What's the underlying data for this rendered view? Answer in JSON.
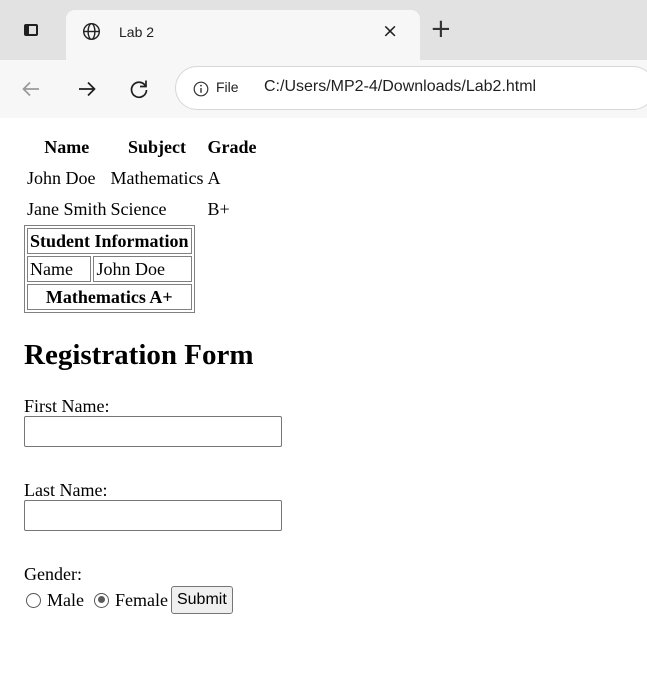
{
  "browser": {
    "tab_title": "Lab 2",
    "close_glyph": "×",
    "new_tab_glyph": "+",
    "file_label": "File",
    "url": "C:/Users/MP2-4/Downloads/Lab2.html",
    "icons": [
      "window-icon",
      "globe-icon",
      "back-icon",
      "forward-icon",
      "reload-icon",
      "info-icon"
    ]
  },
  "grades_table": {
    "headers": [
      "Name",
      "Subject",
      "Grade"
    ],
    "rows": [
      [
        "John Doe",
        "Mathematics",
        "A"
      ],
      [
        "Jane Smith",
        "Science",
        "B+"
      ]
    ]
  },
  "info_table": {
    "caption_header": "Student Information",
    "name_label": "Name",
    "name_value": "John Doe",
    "footer_header": "Mathematics A+"
  },
  "form": {
    "title": "Registration Form",
    "first_name_label": "First Name:",
    "first_name_value": "",
    "last_name_label": "Last Name:",
    "last_name_value": "",
    "gender_label": "Gender:",
    "gender_options": [
      "Male",
      "Female"
    ],
    "gender_selected": "Female",
    "submit_label": "Submit"
  }
}
